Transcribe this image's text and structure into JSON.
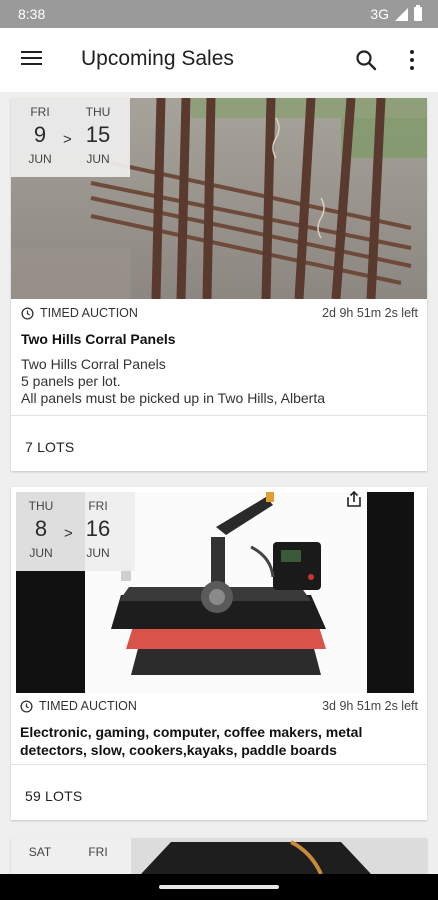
{
  "status_bar": {
    "time": "8:38",
    "network": "3G"
  },
  "app_bar": {
    "title": "Upcoming Sales",
    "icons": [
      "menu-icon",
      "search-icon",
      "more-vert-icon"
    ]
  },
  "sales": [
    {
      "start": {
        "dow": "FRI",
        "day": "9",
        "month": "JUN"
      },
      "end": {
        "dow": "THU",
        "day": "15",
        "month": "JUN"
      },
      "arrow": ">",
      "type": "TIMED AUCTION",
      "time_left": "2d 9h 51m 2s left",
      "title": "Two Hills Corral Panels",
      "description": [
        "Two Hills Corral Panels",
        "5 panels per lot.",
        "All panels must be picked up in Two Hills, Alberta"
      ],
      "lots": "7 LOTS"
    },
    {
      "start": {
        "dow": "THU",
        "day": "8",
        "month": "JUN"
      },
      "end": {
        "dow": "FRI",
        "day": "16",
        "month": "JUN"
      },
      "arrow": ">",
      "type": "TIMED AUCTION",
      "time_left": "3d 9h 51m 2s left",
      "title": "Electronic, gaming, computer, coffee makers, metal detectors, slow, cookers,kayaks, paddle boards",
      "lots": "59 LOTS"
    },
    {
      "start": {
        "dow": "SAT"
      },
      "end": {
        "dow": "FRI"
      }
    }
  ],
  "colors": {
    "status_bar": "#9a9a9a",
    "surface": "#ffffff",
    "background": "#efefef",
    "heat_pad": "#d9534a"
  }
}
